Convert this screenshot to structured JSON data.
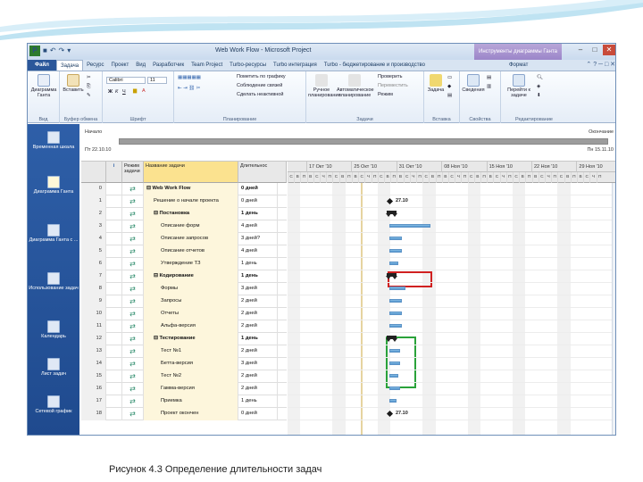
{
  "window": {
    "title": "Web Work Flow - Microsoft Project",
    "context_tab": "Инструменты диаграммы Ганта",
    "app_icon_letter": "P"
  },
  "ribbon_tabs": [
    "Файл",
    "Задача",
    "Ресурс",
    "Проект",
    "Вид",
    "Разработчик",
    "Team Project",
    "Тurbo-ресурсы",
    "Turbo интеграция",
    "Turbo - бюджетирование и производство"
  ],
  "format_tab": "Формат",
  "ribbon": {
    "view": {
      "gantt_label": "Диаграмма Ганта",
      "group": "Вид"
    },
    "clipboard": {
      "paste_label": "Вставить",
      "group": "Буфер обмена"
    },
    "font": {
      "font_name": "Calibri",
      "font_size": "11",
      "bold": "Ж",
      "italic": "К",
      "underline": "Ч",
      "group": "Шрифт"
    },
    "schedule": {
      "mark_on_track": "Пометить по графику",
      "respect_links": "Соблюдение связей",
      "inactivate": "Сделать неактивной",
      "group": "Планирование"
    },
    "tasks": {
      "manual": "Ручное планирование",
      "auto": "Автоматическое планирование",
      "inspect": "Проверить",
      "move": "Переместить",
      "mode": "Режим",
      "group": "Задачи"
    },
    "insert": {
      "task": "Задача",
      "group": "Вставка"
    },
    "properties": {
      "info": "Сведения",
      "group": "Свойства"
    },
    "editing": {
      "scroll_to_task": "Перейти к задаче",
      "group": "Редактирование"
    }
  },
  "sidebar": [
    {
      "label": "Временная шкала"
    },
    {
      "label": "Диаграмма Ганта"
    },
    {
      "label": "Диаграмма Ганта с ..."
    },
    {
      "label": "Использование задач"
    },
    {
      "label": "Календарь"
    },
    {
      "label": "Лист задач"
    },
    {
      "label": "Сетевой график"
    }
  ],
  "timeline": {
    "start_label": "Начало",
    "start_date": "Пт 22.10.10",
    "end_label": "Окончание",
    "end_date": "Пн 15.11.10"
  },
  "columns": {
    "info": "i",
    "mode": "Режим задачи",
    "name": "Название задачи",
    "duration": "Длительнос"
  },
  "rows": [
    {
      "id": "0",
      "name": "Web Work Flow",
      "duration": "0 дней",
      "level": 0,
      "summary": true
    },
    {
      "id": "1",
      "name": "Решение о начале проекта",
      "duration": "0 дней",
      "level": 1,
      "summary": false,
      "two_line": true
    },
    {
      "id": "2",
      "name": "Постановка",
      "duration": "1 день",
      "level": 1,
      "summary": true
    },
    {
      "id": "3",
      "name": "Описание форм",
      "duration": "4 дней",
      "level": 2,
      "summary": false
    },
    {
      "id": "4",
      "name": "Описание запросов",
      "duration": "3 дней?",
      "level": 2,
      "summary": false
    },
    {
      "id": "5",
      "name": "Описание отчетов",
      "duration": "4 дней",
      "level": 2,
      "summary": false
    },
    {
      "id": "6",
      "name": "Утверждение ТЗ",
      "duration": "1 день",
      "level": 2,
      "summary": false
    },
    {
      "id": "7",
      "name": "Кодирование",
      "duration": "1 день",
      "level": 1,
      "summary": true
    },
    {
      "id": "8",
      "name": "Формы",
      "duration": "3 дней",
      "level": 2,
      "summary": false
    },
    {
      "id": "9",
      "name": "Запросы",
      "duration": "2 дней",
      "level": 2,
      "summary": false
    },
    {
      "id": "10",
      "name": "Отчеты",
      "duration": "2 дней",
      "level": 2,
      "summary": false
    },
    {
      "id": "11",
      "name": "Альфа-версия",
      "duration": "2 дней",
      "level": 2,
      "summary": false
    },
    {
      "id": "12",
      "name": "Тестирование",
      "duration": "1 день",
      "level": 1,
      "summary": true
    },
    {
      "id": "13",
      "name": "Тест №1",
      "duration": "2 дней",
      "level": 2,
      "summary": false
    },
    {
      "id": "14",
      "name": "Бетта-версия",
      "duration": "3 дней",
      "level": 2,
      "summary": false
    },
    {
      "id": "15",
      "name": "Тест №2",
      "duration": "2 дней",
      "level": 2,
      "summary": false
    },
    {
      "id": "16",
      "name": "Гамма-версия",
      "duration": "2 дней",
      "level": 2,
      "summary": false
    },
    {
      "id": "17",
      "name": "Приемка",
      "duration": "1 день",
      "level": 2,
      "summary": false
    },
    {
      "id": "18",
      "name": "Проект окончен",
      "duration": "0 дней",
      "level": 2,
      "summary": false
    }
  ],
  "gantt": {
    "weeks": [
      "17 Окт '10",
      "25 Окт '10",
      "31 Окт '10",
      "08 Ноя '10",
      "15 Ноя '10",
      "22 Ноя '10",
      "29 Ноя '10"
    ],
    "day_letters": [
      "С",
      "В",
      "П",
      "В",
      "С",
      "Ч",
      "П",
      "С",
      "В",
      "П",
      "В",
      "С",
      "Ч",
      "П",
      "С",
      "В",
      "П",
      "В",
      "С",
      "Ч",
      "П",
      "С",
      "В",
      "П",
      "В",
      "С",
      "Ч",
      "П",
      "С",
      "В",
      "П",
      "В",
      "С",
      "Ч",
      "П",
      "С",
      "В",
      "П",
      "В",
      "С",
      "Ч",
      "П",
      "С",
      "В",
      "П",
      "В",
      "С",
      "Ч",
      "П"
    ],
    "milestone_start": "27.10",
    "milestone_end": "27.10"
  },
  "caption": "Рисунок 4.3 Определение длительности задач",
  "colors": {
    "file_tab": "#2b579a",
    "sidebar": "#2e5fa8",
    "task_bar": "#4c8fcc",
    "highlight_red": "#d02020",
    "highlight_green": "#2aa23a"
  }
}
